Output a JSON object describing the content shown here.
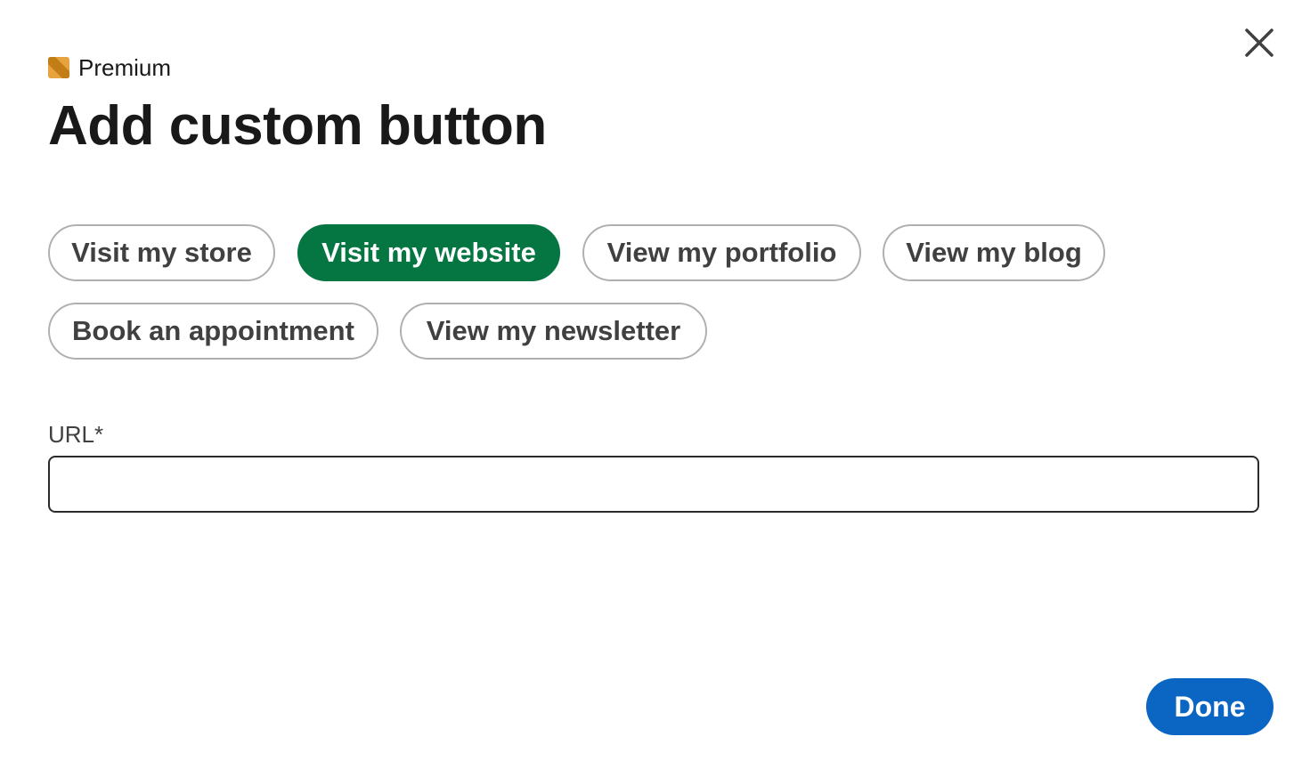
{
  "header": {
    "badge_label": "Premium",
    "badge_icon": "premium-badge-icon",
    "title": "Add custom button",
    "close_icon": "close-icon"
  },
  "options": [
    {
      "label": "Visit my store",
      "selected": false
    },
    {
      "label": "Visit my website",
      "selected": true
    },
    {
      "label": "View my portfolio",
      "selected": false
    },
    {
      "label": "View my blog",
      "selected": false
    },
    {
      "label": "Book an appointment",
      "selected": false
    },
    {
      "label": "View my newsletter",
      "selected": false
    }
  ],
  "url_field": {
    "label": "URL*",
    "value": "",
    "placeholder": ""
  },
  "footer": {
    "done_label": "Done"
  },
  "colors": {
    "selected_chip": "#057642",
    "primary_button": "#0a66c2",
    "premium_gold": "#c37d16"
  }
}
